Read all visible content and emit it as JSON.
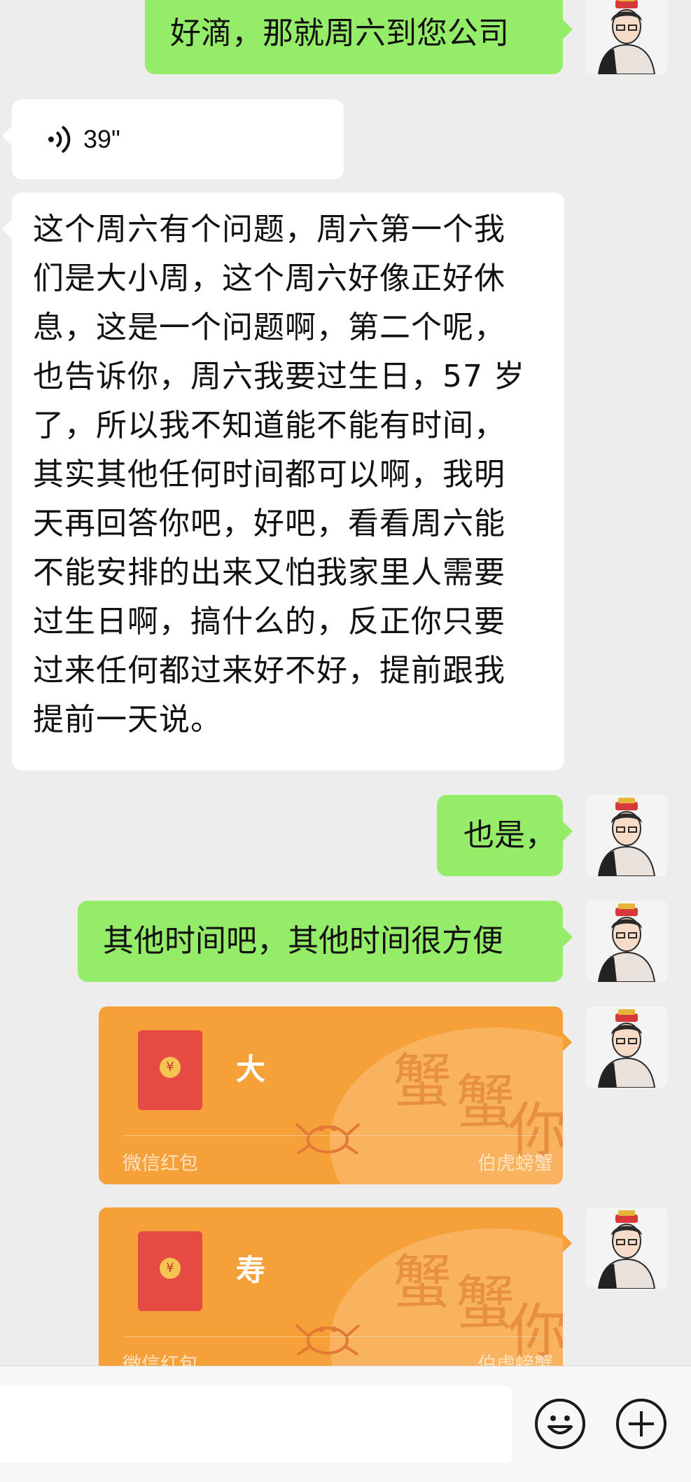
{
  "messages": [
    {
      "side": "right",
      "type": "text",
      "text": "好滴，那就周六到您公司"
    },
    {
      "side": "left",
      "type": "voice",
      "duration": "39\""
    },
    {
      "side": "left",
      "type": "text",
      "lines": [
        "这个周六有个问题，周六第一个我",
        "们是大小周，这个周六好像正好休",
        "息，这是一个问题啊，第二个呢，",
        "也告诉你，周六我要过生日，57 岁",
        "了，所以我不知道能不能有时间，",
        "其实其他任何时间都可以啊，我明",
        "天再回答你吧，好吧，看看周六能",
        "不能安排的出来又怕我家里人需要",
        "过生日啊，搞什么的，反正你只要",
        "过来任何都过来好不好，提前跟我",
        "提前一天说。"
      ]
    },
    {
      "side": "right",
      "type": "text",
      "text": "也是，"
    },
    {
      "side": "right",
      "type": "text",
      "text": "其他时间吧，其他时间很方便"
    },
    {
      "side": "right",
      "type": "red_packet",
      "title": "大",
      "source": "微信红包",
      "brand": "伯虎螃蟹",
      "deco": [
        "蟹",
        "蟹",
        "你"
      ]
    },
    {
      "side": "right",
      "type": "red_packet",
      "title": "寿",
      "source": "微信红包",
      "brand": "伯虎螃蟹",
      "deco": [
        "蟹",
        "蟹",
        "你"
      ]
    }
  ],
  "input_bar": {
    "emoji_icon": "smiley-icon",
    "plus_icon": "plus-icon"
  },
  "colors": {
    "background": "#ededed",
    "self_bubble": "#95ec69",
    "other_bubble": "#ffffff",
    "red_packet": "#f6a03a",
    "envelope": "#e54b43"
  }
}
